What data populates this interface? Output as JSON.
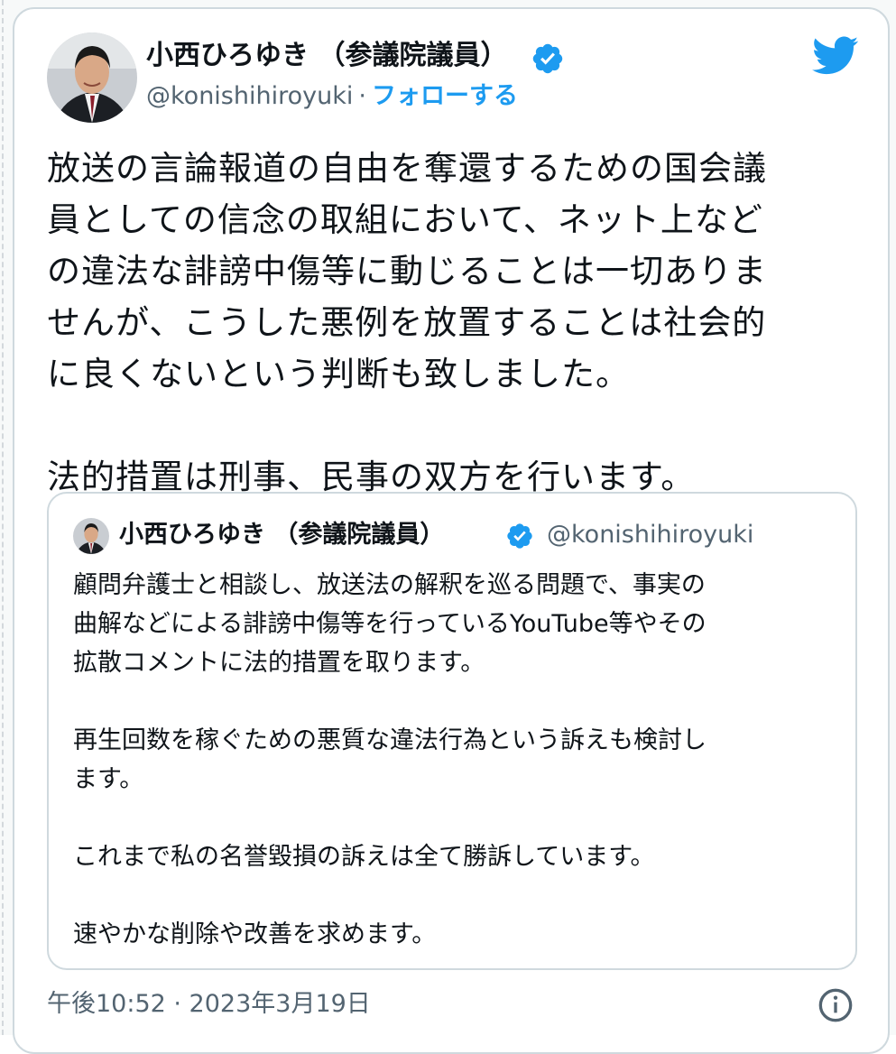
{
  "tweet": {
    "author_name": "小西ひろゆき （参議院議員）",
    "handle": "@konishihiroyuki",
    "separator": "·",
    "follow_label": "フォローする",
    "text": "放送の言論報道の自由を奪還するための国会議\n員としての信念の取組において、ネット上など\nの違法な誹謗中傷等に動じることは一切ありま\nせんが、こうした悪例を放置することは社会的\nに良くないという判断も致しました。\n\n法的措置は刑事、民事の双方を行います。",
    "timestamp": "午後10:52 · 2023年3月19日"
  },
  "quoted_tweet": {
    "author_name": "小西ひろゆき （参議院議員）",
    "handle": "@konishihiroyuki",
    "text": "顧問弁護士と相談し、放送法の解釈を巡る問題で、事実の\n曲解などによる誹謗中傷等を行っているYouTube等やその\n拡散コメントに法的措置を取ります。\n\n再生回数を稼ぐための悪質な違法行為という訴えも検討し\nます。\n\nこれまで私の名誉毀損の訴えは全て勝訴しています。\n\n速やかな削除や改善を求めます。"
  },
  "icons": {
    "brand": "twitter-bird-icon",
    "verified": "verified-badge-icon",
    "info": "info-icon"
  },
  "colors": {
    "accent": "#1d9bf0",
    "text": "#0f1419",
    "secondary_text": "#536471",
    "border": "#cfd9de"
  }
}
